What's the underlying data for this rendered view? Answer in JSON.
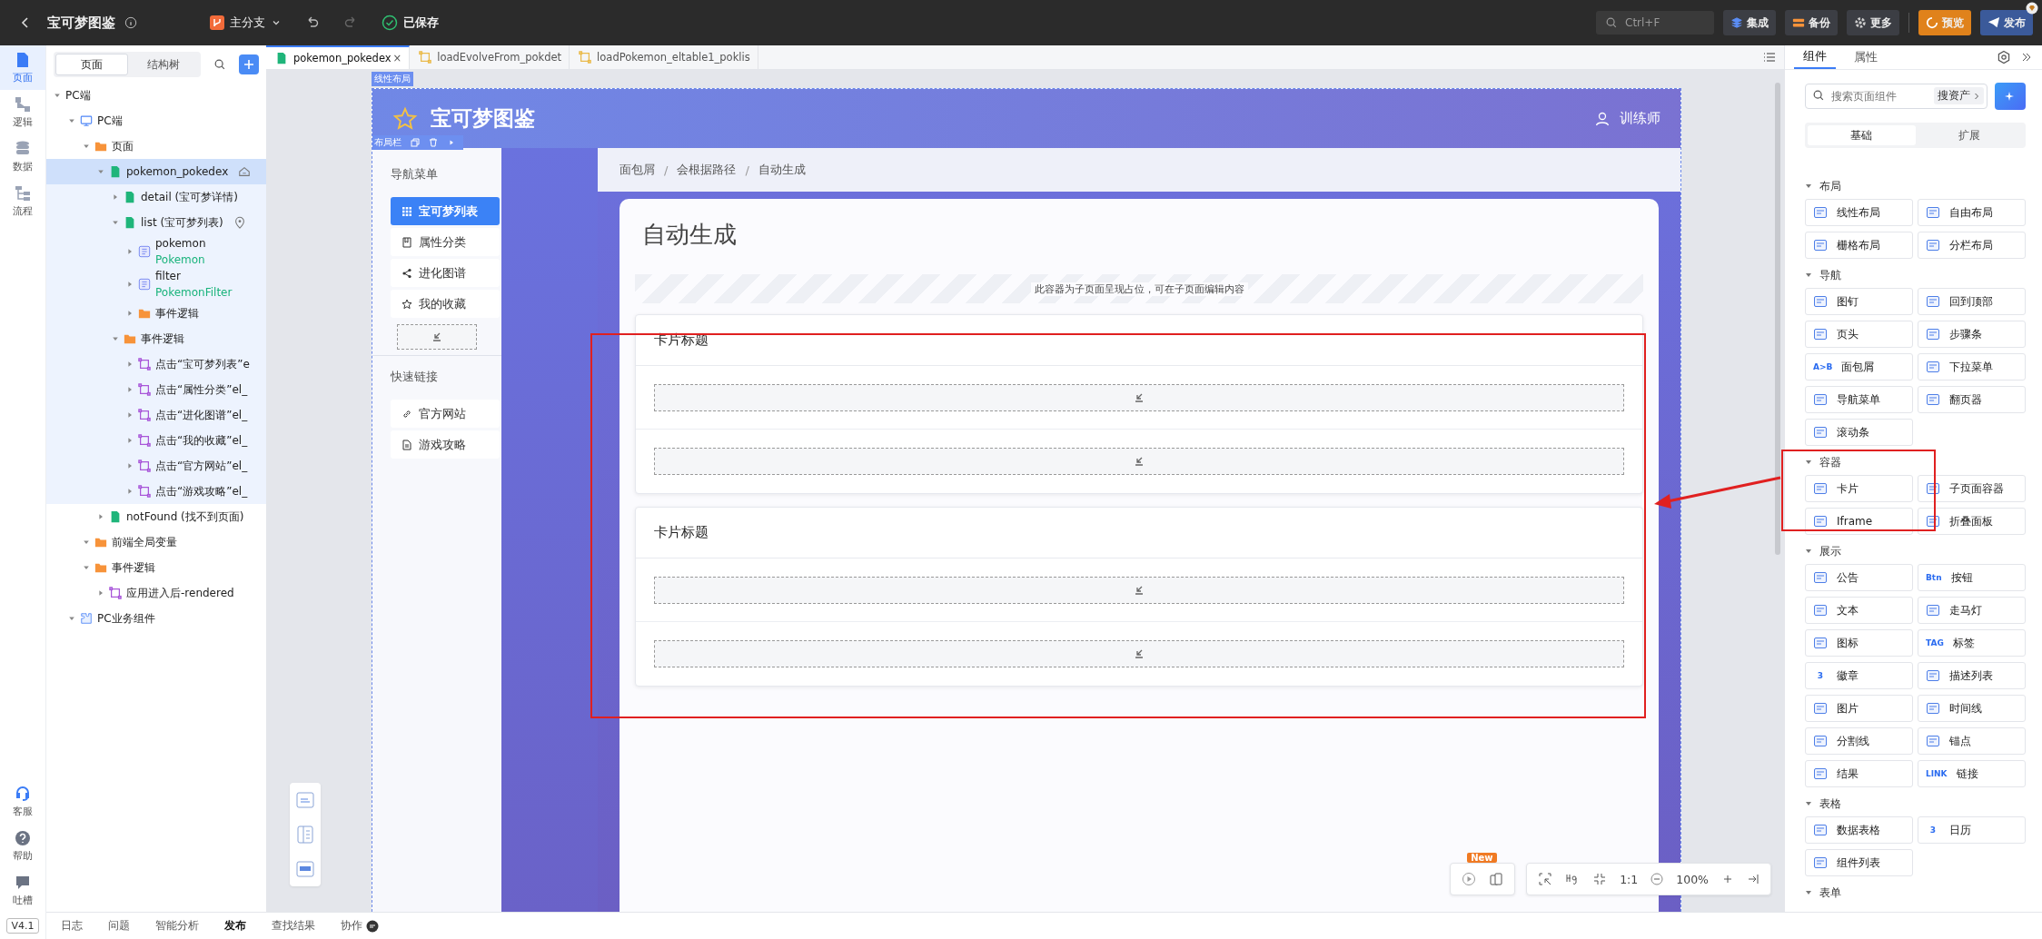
{
  "topbar": {
    "title": "宝可梦图鉴",
    "branch": "主分支",
    "save_status": "已保存",
    "search": {
      "placeholder": "Ctrl+F"
    },
    "actions": [
      {
        "label": "集成",
        "kind": "integrate"
      },
      {
        "label": "备份",
        "kind": "backup"
      },
      {
        "label": "更多",
        "kind": "more"
      },
      {
        "label": "预览",
        "kind": "preview"
      },
      {
        "label": "发布",
        "kind": "publish"
      }
    ]
  },
  "rail": {
    "items": [
      {
        "label": "页面",
        "kind": "page",
        "selected": true
      },
      {
        "label": "逻辑",
        "kind": "logic",
        "selected": false
      },
      {
        "label": "数据",
        "kind": "data",
        "selected": false
      },
      {
        "label": "流程",
        "kind": "flow",
        "selected": false
      }
    ],
    "bottom": [
      {
        "label": "客服",
        "kind": "service"
      },
      {
        "label": "帮助",
        "kind": "help"
      },
      {
        "label": "吐槽",
        "kind": "feedback"
      }
    ],
    "version": "V4.1"
  },
  "explorer": {
    "tabs": [
      {
        "label": "页面",
        "selected": true
      },
      {
        "label": "结构树",
        "selected": false
      }
    ],
    "tree": [
      {
        "label": "PC端",
        "expanded": true,
        "selected": false,
        "children": [
          {
            "label": "PC端",
            "kind": "pc",
            "expanded": true,
            "selected": false,
            "children": [
              {
                "label": "页面",
                "kind": "folder",
                "expanded": true,
                "selected": false,
                "children": [
                  {
                    "label": "pokemon_pokedex",
                    "kind": "page",
                    "home": true,
                    "expanded": true,
                    "selected": true,
                    "children": [
                      {
                        "label": "detail (宝可梦详情)",
                        "kind": "page",
                        "expanded": false,
                        "selected": false
                      },
                      {
                        "label": "list (宝可梦列表)",
                        "kind": "page",
                        "pinned": true,
                        "expanded": true,
                        "selected": false,
                        "children": [
                          {
                            "label": "pokemon",
                            "sub": "Pokemon",
                            "kind": "entity",
                            "expanded": false,
                            "selected": false
                          },
                          {
                            "label": "filter",
                            "sub": "PokemonFilter",
                            "kind": "entity",
                            "expanded": false,
                            "selected": false
                          },
                          {
                            "label": "事件逻辑",
                            "kind": "folder",
                            "expanded": false,
                            "selected": false
                          }
                        ]
                      },
                      {
                        "label": "事件逻辑",
                        "kind": "folder",
                        "expanded": true,
                        "selected": false,
                        "children": [
                          {
                            "label": "点击“宝可梦列表”e",
                            "kind": "logic",
                            "expanded": false,
                            "selected": false
                          },
                          {
                            "label": "点击“属性分类”el_",
                            "kind": "logic",
                            "expanded": false,
                            "selected": false
                          },
                          {
                            "label": "点击“进化图谱”el_",
                            "kind": "logic",
                            "expanded": false,
                            "selected": false
                          },
                          {
                            "label": "点击“我的收藏”el_",
                            "kind": "logic",
                            "expanded": false,
                            "selected": false
                          },
                          {
                            "label": "点击“官方网站”el_",
                            "kind": "logic",
                            "expanded": false,
                            "selected": false
                          },
                          {
                            "label": "点击“游戏攻略”el_",
                            "kind": "logic",
                            "expanded": false,
                            "selected": false
                          }
                        ]
                      }
                    ]
                  },
                  {
                    "label": "notFound (找不到页面)",
                    "kind": "page",
                    "expanded": false,
                    "selected": false
                  }
                ]
              },
              {
                "label": "前端全局变量",
                "kind": "folder",
                "expanded": true,
                "selected": false
              },
              {
                "label": "事件逻辑",
                "kind": "folder",
                "expanded": true,
                "selected": false,
                "children": [
                  {
                    "label": "应用进入后-rendered",
                    "kind": "logic",
                    "expanded": false,
                    "selected": false
                  }
                ]
              }
            ]
          },
          {
            "label": "PC业务组件",
            "kind": "component",
            "expanded": true,
            "selected": false
          }
        ]
      }
    ]
  },
  "editor_tabs": [
    {
      "label": "pokemon_pokedex",
      "kind": "page",
      "close": "×",
      "selected": true
    },
    {
      "label": "loadEvolveFrom_pokdet",
      "kind": "logic",
      "selected": false
    },
    {
      "label": "loadPokemon_eltable1_poklis",
      "kind": "logic",
      "selected": false
    }
  ],
  "canvas": {
    "layout_tag": "线性布局",
    "toolbar_tag": "布局栏",
    "app_title": "宝可梦图鉴",
    "user": "训练师",
    "nav_heading": "导航菜单",
    "nav_items": [
      {
        "label": "宝可梦列表",
        "kind": "grid",
        "selected": true
      },
      {
        "label": "属性分类",
        "kind": "book",
        "selected": false
      },
      {
        "label": "进化图谱",
        "kind": "share",
        "selected": false
      },
      {
        "label": "我的收藏",
        "kind": "star",
        "selected": false
      }
    ],
    "links_heading": "快速链接",
    "links": [
      {
        "label": "官方网站",
        "kind": "link"
      },
      {
        "label": "游戏攻略",
        "kind": "doc"
      }
    ],
    "breadcrumb": [
      "面包屑",
      "会根据路径",
      "自动生成"
    ],
    "breadcrumb_separator": "/",
    "heading": "自动生成",
    "subpage_note": "此容器为子页面呈现占位，可在子页面编辑内容",
    "cards": [
      {
        "title": "卡片标题",
        "rows": [
          {
            "kind": "slot"
          },
          {
            "kind": "slot"
          }
        ]
      },
      {
        "title": "卡片标题",
        "rows": [
          {
            "kind": "slot"
          },
          {
            "kind": "slot"
          }
        ]
      }
    ],
    "zoom_bar": {
      "new_badge": "New",
      "ratio": "1:1",
      "zoom": "100%"
    }
  },
  "components": {
    "tabs": [
      {
        "label": "组件",
        "selected": true
      },
      {
        "label": "属性",
        "selected": false
      }
    ],
    "search": {
      "placeholder": "搜索页面组件"
    },
    "asset_button": "搜资产",
    "segments": [
      {
        "label": "基础",
        "selected": true
      },
      {
        "label": "扩展",
        "selected": false
      }
    ],
    "groups": [
      {
        "title": "布局",
        "items": [
          {
            "label": "线性布局"
          },
          {
            "label": "自由布局"
          },
          {
            "label": "栅格布局"
          },
          {
            "label": "分栏布局"
          }
        ]
      },
      {
        "title": "导航",
        "items": [
          {
            "label": "图钉"
          },
          {
            "label": "回到顶部"
          },
          {
            "label": "页头"
          },
          {
            "label": "步骤条"
          },
          {
            "label": "面包屑",
            "icon_text": "A>B"
          },
          {
            "label": "下拉菜单"
          },
          {
            "label": "导航菜单"
          },
          {
            "label": "翻页器"
          },
          {
            "label": "滚动条"
          }
        ]
      },
      {
        "title": "容器",
        "items": [
          {
            "label": "卡片"
          },
          {
            "label": "子页面容器"
          },
          {
            "label": "Iframe"
          },
          {
            "label": "折叠面板"
          }
        ]
      },
      {
        "title": "展示",
        "items": [
          {
            "label": "公告"
          },
          {
            "label": "按钮",
            "icon_text": "Btn"
          },
          {
            "label": "文本"
          },
          {
            "label": "走马灯"
          },
          {
            "label": "图标"
          },
          {
            "label": "标签",
            "icon_text": "TAG"
          },
          {
            "label": "徽章",
            "icon_text": "3"
          },
          {
            "label": "描述列表"
          },
          {
            "label": "图片"
          },
          {
            "label": "时间线"
          },
          {
            "label": "分割线"
          },
          {
            "label": "锚点"
          },
          {
            "label": "结果"
          },
          {
            "label": "链接",
            "icon_text": "LINK"
          }
        ]
      },
      {
        "title": "表格",
        "items": [
          {
            "label": "数据表格"
          },
          {
            "label": "日历",
            "icon_text": "3"
          },
          {
            "label": "组件列表"
          }
        ]
      },
      {
        "title": "表单"
      }
    ]
  },
  "bottom_tabs": [
    {
      "label": "日志",
      "selected": false
    },
    {
      "label": "问题",
      "selected": false
    },
    {
      "label": "智能分析",
      "selected": false
    },
    {
      "label": "发布",
      "selected": true
    },
    {
      "label": "查找结果",
      "selected": false
    },
    {
      "label": "协作",
      "selected": false,
      "kind": "chat"
    }
  ]
}
